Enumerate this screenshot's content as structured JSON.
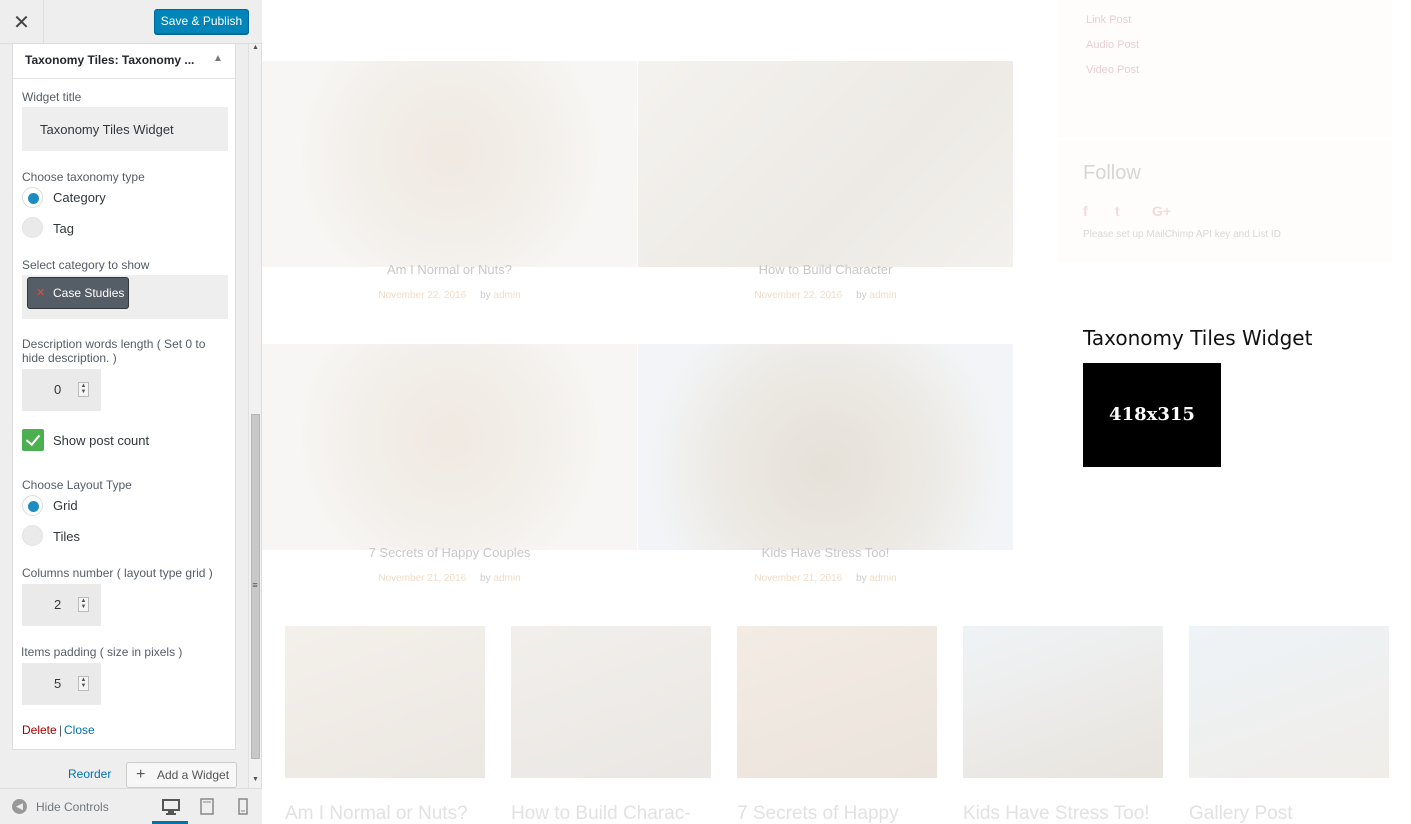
{
  "header": {
    "close_icon": "close-icon",
    "save_label": "Save & Publish"
  },
  "widget": {
    "title": "Taxonomy Tiles: Taxonomy ...",
    "title_label": "Widget title",
    "title_value": "Taxonomy Tiles Widget",
    "taxonomy_label": "Choose taxonomy type",
    "taxonomy_options": [
      "Category",
      "Tag"
    ],
    "taxonomy_selected": "Category",
    "category_label": "Select category to show",
    "category_chip": "Case Studies",
    "desc_label": "Description words length ( Set 0 to hide description. )",
    "desc_value": "0",
    "post_count_label": "Show post count",
    "post_count_checked": true,
    "layout_label": "Choose Layout Type",
    "layout_options": [
      "Grid",
      "Tiles"
    ],
    "layout_selected": "Grid",
    "columns_label": "Columns number ( layout type grid )",
    "columns_value": "2",
    "padding_label": "Items padding ( size in pixels )",
    "padding_value": "5",
    "delete_label": "Delete",
    "separator": "|",
    "close_label": "Close"
  },
  "panel_actions": {
    "reorder_label": "Reorder",
    "add_widget_label": "Add a Widget"
  },
  "footer": {
    "hide_controls_label": "Hide Controls",
    "devices": [
      "desktop-icon",
      "tablet-icon",
      "mobile-icon"
    ],
    "active_device": "desktop"
  },
  "preview": {
    "posts": [
      {
        "title": "Am I Normal or Nuts?",
        "date": "November 22, 2016",
        "by": "by",
        "author": "admin"
      },
      {
        "title": "How to Build Character",
        "date": "November 22, 2016",
        "by": "by",
        "author": "admin"
      },
      {
        "title": "7 Secrets of Happy Couples",
        "date": "November 21, 2016",
        "by": "by",
        "author": "admin"
      },
      {
        "title": "Kids Have Stress Too!",
        "date": "November 21, 2016",
        "by": "by",
        "author": "admin"
      }
    ],
    "sidebar_links": [
      "Link Post",
      "Audio Post",
      "Video Post"
    ],
    "follow_title": "Follow",
    "social_icons": [
      "facebook-icon",
      "twitter-icon",
      "google-plus-icon"
    ],
    "social_glyphs": [
      "f",
      "t",
      "G+"
    ],
    "mailchimp_note": "Please set up MailChimp API key and List ID",
    "taxonomy_widget_title": "Taxonomy Tiles Widget",
    "taxonomy_thumb_label": "418x315",
    "bottom_titles": [
      "Am I Normal or Nuts?",
      "How to Build Charac-",
      "7 Secrets of Happy",
      "Kids Have Stress Too!",
      "Gallery Post"
    ]
  },
  "colors": {
    "primary": "#0085ba",
    "link": "#0073aa",
    "delete": "#aa0000",
    "check": "#4caf50",
    "radio": "#1e8cbe"
  }
}
